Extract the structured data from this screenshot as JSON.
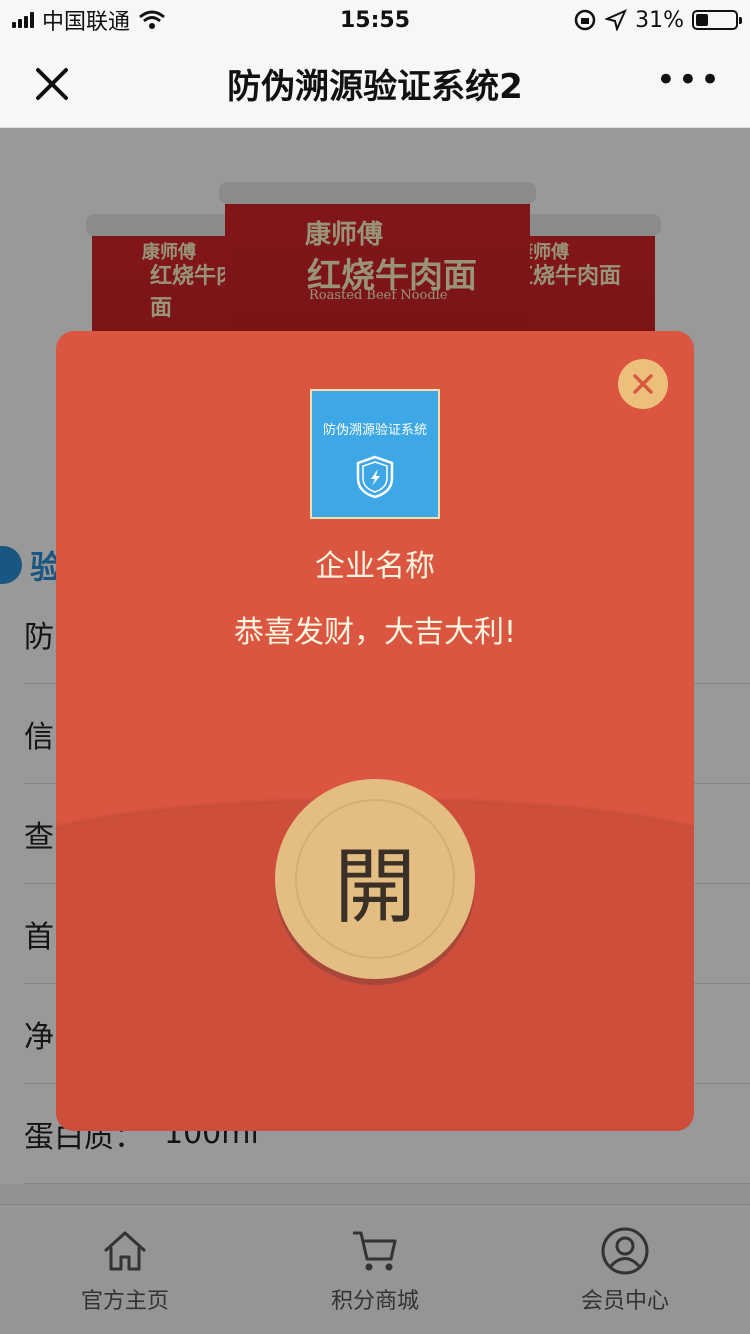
{
  "status_bar": {
    "carrier": "中国联通",
    "time": "15:55",
    "battery": "31%",
    "battery_level": 0.31
  },
  "nav": {
    "title": "防伪溯源验证系统2",
    "more": "•••"
  },
  "banner": {
    "product_label": "红烧牛肉面",
    "brand": "康师傅",
    "subtitle": "Roasted Beef Noodle"
  },
  "info": {
    "section_title": "验",
    "rows": [
      {
        "label": "防",
        "value": ""
      },
      {
        "label": "信",
        "value": ""
      },
      {
        "label": "查",
        "value": ""
      },
      {
        "label": "首",
        "value": ""
      },
      {
        "label": "净",
        "value": ""
      },
      {
        "label": "蛋白质：",
        "value": "100ml"
      }
    ]
  },
  "tabs": [
    {
      "label": "官方主页",
      "icon": "home-icon"
    },
    {
      "label": "积分商城",
      "icon": "cart-icon"
    },
    {
      "label": "会员中心",
      "icon": "user-icon"
    }
  ],
  "modal": {
    "logo_text": "防伪溯源验证系统",
    "company": "企业名称",
    "greeting": "恭喜发财，大吉大利!",
    "open_label": "開"
  },
  "colors": {
    "modal_red": "#da5640",
    "gold": "#e3bd82",
    "accent_blue": "#2a8fd8"
  }
}
